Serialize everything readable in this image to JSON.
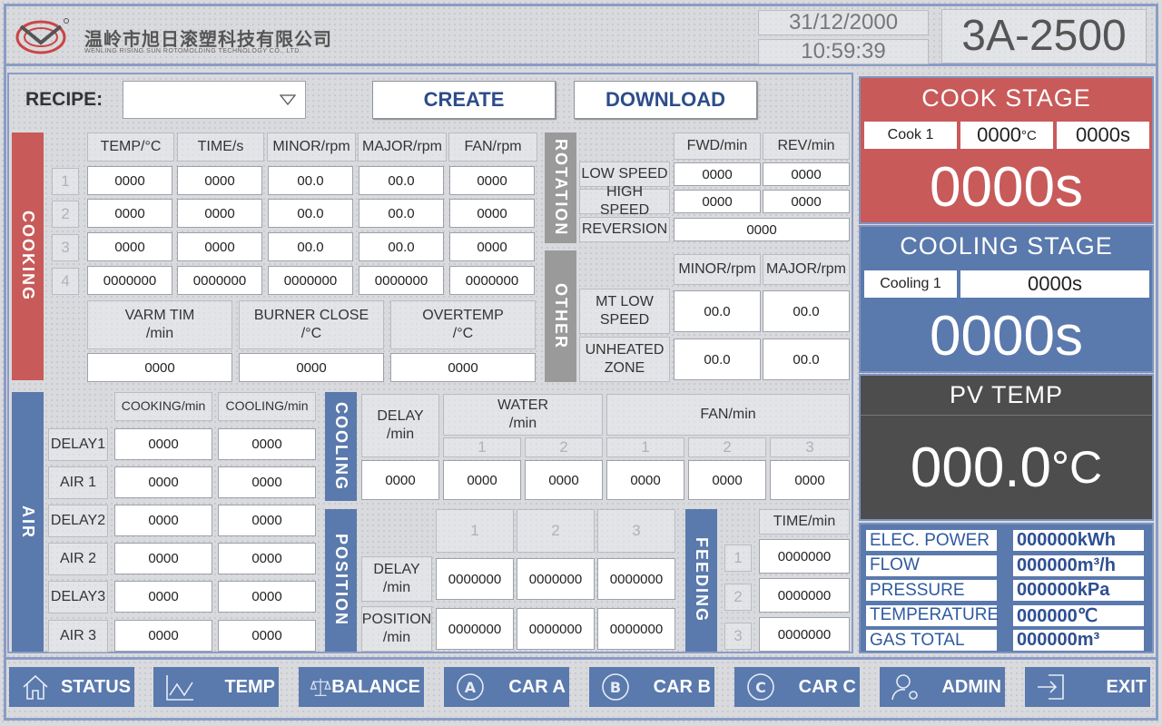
{
  "header": {
    "company_cn": "温岭市旭日滚塑科技有限公司",
    "company_en": "WENLING RISING SUN ROTOMOLDING TECHNOLOGY CO., LTD.",
    "date": "31/12/2000",
    "time": "10:59:39",
    "model": "3A-2500"
  },
  "recipe": {
    "label": "RECIPE:",
    "value": "",
    "create": "CREATE",
    "download": "DOWNLOAD"
  },
  "cooking": {
    "tab": "COOKING",
    "headers": [
      "TEMP/°C",
      "TIME/s",
      "MINOR/rpm",
      "MAJOR/rpm",
      "FAN/rpm"
    ],
    "rows": [
      {
        "n": "1",
        "v": [
          "0000",
          "0000",
          "00.0",
          "00.0",
          "0000"
        ]
      },
      {
        "n": "2",
        "v": [
          "0000",
          "0000",
          "00.0",
          "00.0",
          "0000"
        ]
      },
      {
        "n": "3",
        "v": [
          "0000",
          "0000",
          "00.0",
          "00.0",
          "0000"
        ]
      },
      {
        "n": "4",
        "v": [
          "0000000",
          "0000000",
          "0000000",
          "0000000",
          "0000000"
        ]
      }
    ],
    "warm_label_1": "VARM TIM",
    "warm_label_2": "/min",
    "warm_value": "0000",
    "burner_label_1": "BURNER CLOSE",
    "burner_label_2": "/°C",
    "burner_value": "0000",
    "over_label_1": "OVERTEMP",
    "over_label_2": "/°C",
    "over_value": "0000"
  },
  "rotation": {
    "tab": "ROTATION",
    "fwd": "FWD/min",
    "rev": "REV/min",
    "low": "LOW SPEED",
    "low_fwd": "0000",
    "low_rev": "0000",
    "high": "HIGH SPEED",
    "high_fwd": "0000",
    "high_rev": "0000",
    "reversion": "REVERSION",
    "reversion_value": "0000"
  },
  "other": {
    "tab": "OTHER",
    "minor": "MINOR/rpm",
    "major": "MAJOR/rpm",
    "mt1": "MT LOW",
    "mt2": "SPEED",
    "mt_minor": "00.0",
    "mt_major": "00.0",
    "un1": "UNHEATED",
    "un2": "ZONE",
    "un_minor": "00.0",
    "un_major": "00.0"
  },
  "air": {
    "tab": "AIR",
    "cooking": "COOKING/min",
    "cooling": "COOLING/min",
    "rows": [
      {
        "l": "DELAY1",
        "a": "0000",
        "b": "0000"
      },
      {
        "l": "AIR 1",
        "a": "0000",
        "b": "0000"
      },
      {
        "l": "DELAY2",
        "a": "0000",
        "b": "0000"
      },
      {
        "l": "AIR 2",
        "a": "0000",
        "b": "0000"
      },
      {
        "l": "DELAY3",
        "a": "0000",
        "b": "0000"
      },
      {
        "l": "AIR 3",
        "a": "0000",
        "b": "0000"
      }
    ]
  },
  "cooling": {
    "tab": "COOLING",
    "delay1": "DELAY",
    "delay2": "/min",
    "water1": "WATER",
    "water2": "/min",
    "fan": "FAN/min",
    "w1": "1",
    "w2": "2",
    "f1": "1",
    "f2": "2",
    "f3": "3",
    "values": [
      "0000",
      "0000",
      "0000",
      "0000",
      "0000",
      "0000"
    ]
  },
  "position": {
    "tab": "POSITION",
    "c1": "1",
    "c2": "2",
    "c3": "3",
    "delay1": "DELAY",
    "delay2": "/min",
    "pos1": "POSITION",
    "pos2": "/min",
    "delay_values": [
      "0000000",
      "0000000",
      "0000000"
    ],
    "pos_values": [
      "0000000",
      "0000000",
      "0000000"
    ]
  },
  "feeding": {
    "tab": "FEEDING",
    "time": "TIME/min",
    "rows": [
      {
        "n": "1",
        "v": "0000000"
      },
      {
        "n": "2",
        "v": "0000000"
      },
      {
        "n": "3",
        "v": "0000000"
      }
    ]
  },
  "cook_stage": {
    "title": "COOK STAGE",
    "step": "Cook 1",
    "temp": "0000",
    "temp_unit": "°C",
    "time": "0000s",
    "big": "0000s"
  },
  "cooling_stage": {
    "title": "COOLING STAGE",
    "step": "Cooling 1",
    "time": "0000s",
    "big": "0000s"
  },
  "pv": {
    "title": "PV TEMP",
    "value": "000.0",
    "unit": "°C"
  },
  "stats": [
    {
      "label": "ELEC. POWER",
      "value": "000000kWh"
    },
    {
      "label": "FLOW",
      "value": "000000m³/h"
    },
    {
      "label": "PRESSURE",
      "value": "000000kPa"
    },
    {
      "label": "TEMPERATURE",
      "value": "000000℃"
    },
    {
      "label": "GAS TOTAL",
      "value": "000000m³"
    }
  ],
  "nav": {
    "status": "STATUS",
    "temp": "TEMP",
    "balance": "BALANCE",
    "car_a": "CAR A",
    "car_b": "CAR B",
    "car_c": "CAR C",
    "admin": "ADMIN",
    "exit": "EXIT",
    "a": "A",
    "b": "B",
    "c": "C"
  },
  "colors": {
    "cooking": "#c85a5a",
    "blue": "#5a79ad",
    "dark": "#4d4d4d",
    "grey": "#9a9a9a"
  }
}
